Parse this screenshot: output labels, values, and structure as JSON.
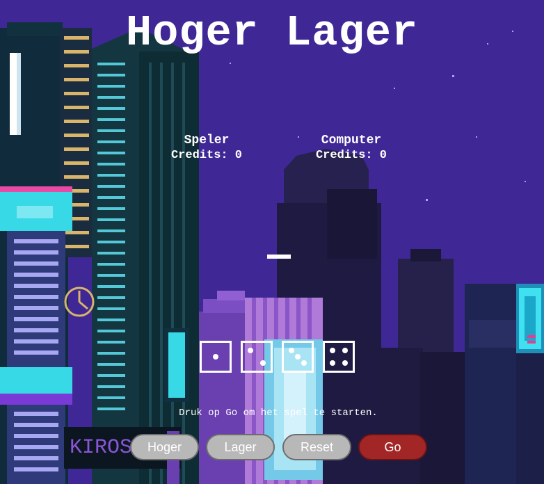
{
  "game": {
    "title": "Hoger Lager"
  },
  "players": [
    {
      "name": "Speler",
      "credits": "Credits: 0"
    },
    {
      "name": "Computer",
      "credits": "Credits: 0"
    }
  ],
  "result_display": "—",
  "dice": [
    1,
    2,
    3,
    4
  ],
  "status": "Druk op Go om het spel te starten.",
  "buttons": {
    "higher": "Hoger",
    "lower": "Lager",
    "reset": "Reset",
    "go": "Go"
  },
  "colors": {
    "sky": "#3f2896",
    "go_button": "#a32626",
    "gray_button": "#b8b8b8",
    "neon_cyan": "#38d9e6",
    "neon_purple": "#8a55d6"
  },
  "background": {
    "sign_text": "KIROS"
  }
}
